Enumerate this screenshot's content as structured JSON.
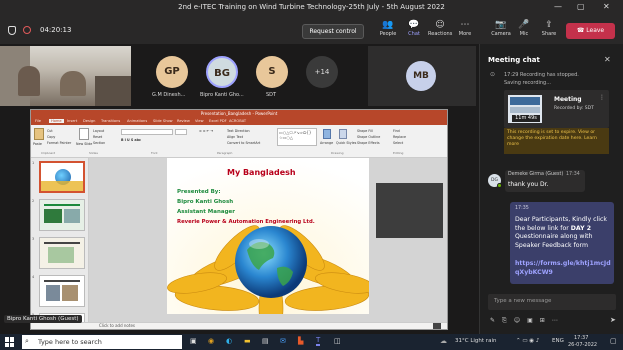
{
  "window": {
    "title": "2nd e-ITEC Training on Wind Turbine Technology-25th July - 5th August 2022",
    "minimize_glyph": "—",
    "restore_glyph": "▢",
    "close_glyph": "✕"
  },
  "meeting_toolbar": {
    "timer": "04:20:13",
    "request_control": "Request control",
    "items": [
      {
        "label": "People",
        "icon": "people-icon"
      },
      {
        "label": "Chat",
        "icon": "chat-icon"
      },
      {
        "label": "Reactions",
        "icon": "reactions-icon"
      },
      {
        "label": "More",
        "icon": "more-icon"
      },
      {
        "label": "Camera",
        "icon": "camera-icon"
      },
      {
        "label": "Mic",
        "icon": "mic-icon"
      },
      {
        "label": "Share",
        "icon": "share-icon"
      }
    ],
    "leave": "Leave"
  },
  "participants": [
    {
      "initials": "GP",
      "name": "G.M Dinesh...",
      "color": "#e8c79a"
    },
    {
      "initials": "BG",
      "name": "Bipro Kanti Gho...",
      "color": "#cfdbe0"
    },
    {
      "initials": "S",
      "name": "SDT",
      "color": "#e8c79a"
    }
  ],
  "overflow_count": "+14",
  "mb_tile": {
    "initials": "MB",
    "color": "#c7d0ea"
  },
  "presenter_label": "Bipro Kanti Ghosh (Guest)",
  "ppt": {
    "window_title": "Presentation_Bangladesh - PowerPoint",
    "tabs": [
      "File",
      "Home",
      "Insert",
      "Design",
      "Transitions",
      "Animations",
      "Slide Show",
      "Review",
      "View",
      "Excel PDF",
      "ACROBAT"
    ],
    "ribbon": {
      "paste": "Paste",
      "cut": "Cut",
      "copy": "Copy",
      "format_painter": "Format Painter",
      "layout": "Layout",
      "reset": "Reset",
      "section": "Section",
      "new_slide": "New Slide",
      "text_direction": "Text Direction",
      "align_text": "Align Text",
      "convert_smartart": "Convert to SmartArt",
      "arrange": "Arrange",
      "quick_styles": "Quick Styles",
      "shape_fill": "Shape Fill",
      "shape_outline": "Shape Outline",
      "shape_effects": "Shape Effects",
      "find": "Find",
      "replace": "Replace",
      "select": "Select",
      "groups": [
        "Clipboard",
        "Slides",
        "Font",
        "Paragraph",
        "Drawing",
        "Editing"
      ]
    },
    "thumb_numbers": [
      "1",
      "2",
      "3",
      "4",
      "5"
    ],
    "slide": {
      "title": "My Bangladesh",
      "presented_by": "Presented By:",
      "name": "Bipro Kanti Ghosh",
      "role": "Assistant Manager",
      "company": "Reverie Power & Automation Engineering Ltd."
    },
    "notes_placeholder": "Click to add notes"
  },
  "chat": {
    "header": "Meeting chat",
    "sys_time": "17:29",
    "sys_line1": "Recording has stopped.",
    "sys_line2": "Saving recording...",
    "rec_title": "Meeting",
    "rec_by": "Recorded by: SDT",
    "rec_duration": "11m 49s",
    "rec_notice": "This recording is set to expire. View or change the expiration date here. Learn more",
    "msg1_author": "Demeke Girma (Guest)",
    "msg1_time": "17:34",
    "msg1_initials": "DG",
    "msg1_text": "thank you Dr.",
    "msg2_time": "17:35",
    "msg2_text_a": "Dear Participants, Kindly click the below link for ",
    "msg2_bold": "DAY 2",
    "msg2_text_b": " Questionnaire along with Speaker Feedback form",
    "msg2_link": "https://forms.gle/khtj1mcJdqXybKCW9",
    "input_placeholder": "Type a new message"
  },
  "taskbar": {
    "search_placeholder": "Type here to search",
    "weather": "31°C  Light rain",
    "lang": "ENG",
    "time": "17:37",
    "date": "26-07-2022"
  },
  "colors": {
    "teams_leave": "#c4314b",
    "ppt_accent": "#b7472a",
    "slide_title": "#b8001a",
    "slide_green": "#1c8a3c",
    "slide_red": "#b8001a"
  }
}
